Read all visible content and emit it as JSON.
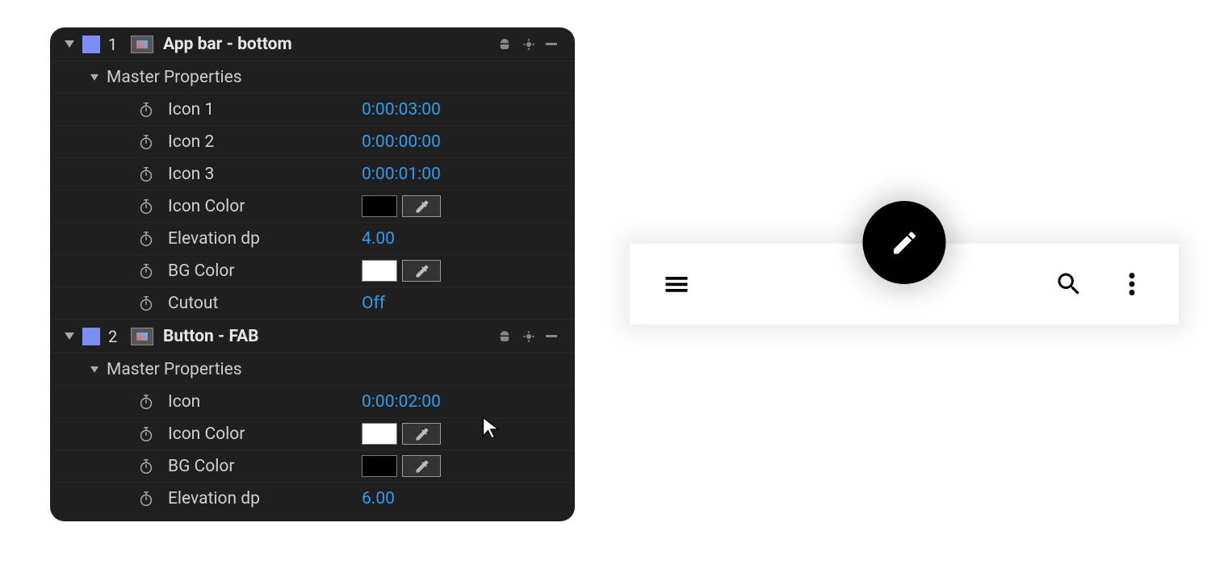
{
  "panel": {
    "layers": [
      {
        "index": "1",
        "name": "App bar - bottom",
        "master_properties_label": "Master Properties",
        "props": [
          {
            "name": "Icon 1",
            "value": "0:00:03:00",
            "kind": "text"
          },
          {
            "name": "Icon 2",
            "value": "0:00:00:00",
            "kind": "text"
          },
          {
            "name": "Icon 3",
            "value": "0:00:01:00",
            "kind": "text"
          },
          {
            "name": "Icon Color",
            "value": "#000000",
            "kind": "color"
          },
          {
            "name": "Elevation dp",
            "value": "4.00",
            "kind": "text"
          },
          {
            "name": "BG Color",
            "value": "#ffffff",
            "kind": "color"
          },
          {
            "name": "Cutout",
            "value": "Off",
            "kind": "text"
          }
        ]
      },
      {
        "index": "2",
        "name": "Button - FAB",
        "master_properties_label": "Master Properties",
        "props": [
          {
            "name": "Icon",
            "value": "0:00:02:00",
            "kind": "text"
          },
          {
            "name": "Icon Color",
            "value": "#ffffff",
            "kind": "color"
          },
          {
            "name": "BG Color",
            "value": "#000000",
            "kind": "color"
          },
          {
            "name": "Elevation dp",
            "value": "6.00",
            "kind": "text"
          }
        ]
      }
    ]
  },
  "preview": {
    "appbar_bg": "#ffffff",
    "appbar_icon_color": "#000000",
    "fab_bg": "#000000",
    "fab_icon_color": "#ffffff",
    "left_icon": "menu",
    "right_icons": [
      "search",
      "more"
    ],
    "fab_icon": "edit"
  }
}
